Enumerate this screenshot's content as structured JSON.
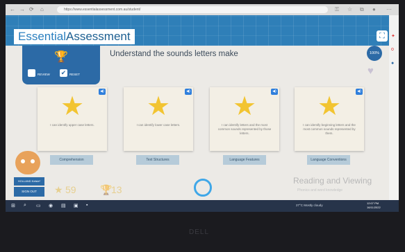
{
  "browser": {
    "url": "https://www.essentialassessment.com.au/student/",
    "nav": [
      "←",
      "→",
      "⟳",
      "⌂"
    ]
  },
  "app": {
    "brand_first": "Essential",
    "brand_second": "Assessment",
    "page_title": "Understand the sounds letters make",
    "progress_badge": "100%",
    "review_label": "REVIEW",
    "reset_label": "RESET"
  },
  "cards": [
    {
      "desc": "I can identify upper case letters.",
      "tag": "Comprehension"
    },
    {
      "desc": "I can identify lower case letters.",
      "tag": "Text Structures"
    },
    {
      "desc": "I can identify letters and the most common sounds represented by those letters.",
      "tag": "Language Features"
    },
    {
      "desc": "I can identify beginning letters and the most common sounds represented by them.",
      "tag": "Language Conventions"
    }
  ],
  "footer": {
    "user_badge": "HOLLAND Kelsie*",
    "signout_label": "SIGN OUT",
    "stars_count": "59",
    "trophies_count": "13",
    "section_title": "Reading and Viewing",
    "section_subtitle": "Phonics and word knowledge"
  },
  "taskbar": {
    "weather": "27°C Mostly cloudy",
    "time": "12:07 PM",
    "date": "16/11/2022"
  },
  "bezel": {
    "brand": "DELL"
  },
  "icons": {
    "trophy": "trophy-icon",
    "star": "star-icon",
    "sound": "sound-icon",
    "heart": "heart-icon",
    "fullscreen": "fullscreen-icon"
  },
  "colors": {
    "header_blue": "#2f7fb8",
    "panel_blue": "#2c6aa6",
    "star_yellow": "#f2c431",
    "tag_blue": "#b6cbd9"
  }
}
